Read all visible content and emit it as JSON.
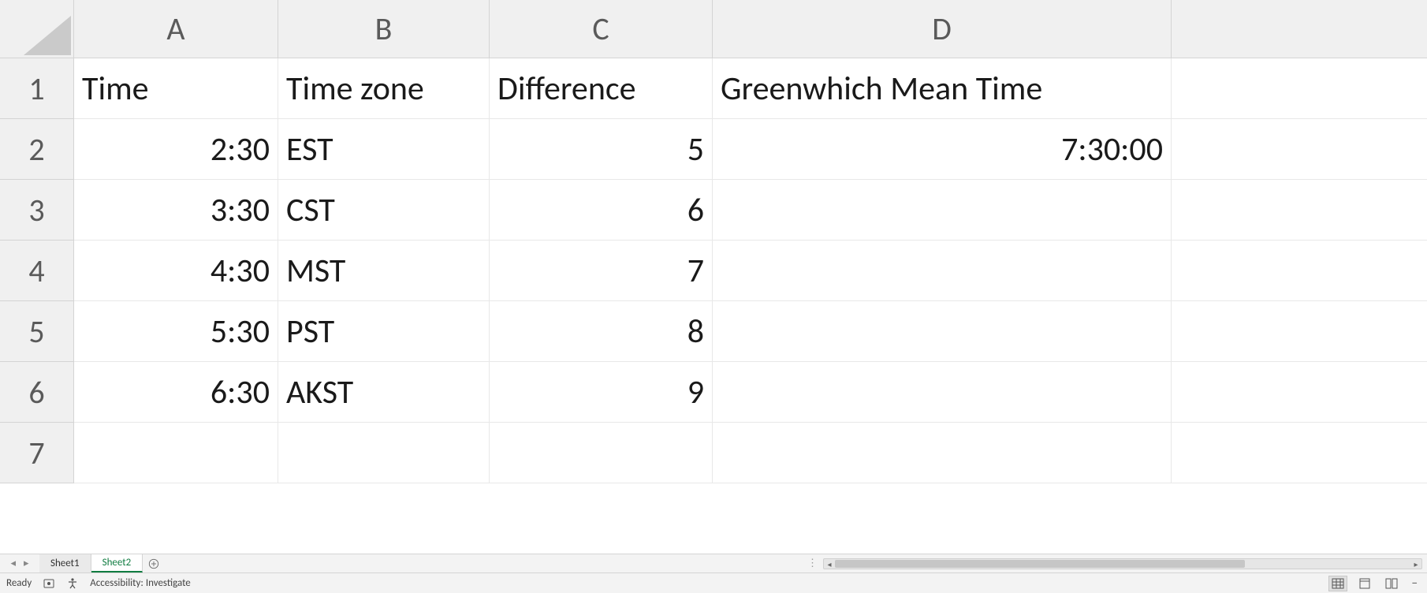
{
  "columns": [
    "A",
    "B",
    "C",
    "D"
  ],
  "rows": [
    "1",
    "2",
    "3",
    "4",
    "5",
    "6",
    "7"
  ],
  "cells": {
    "A1": "Time",
    "B1": "Time zone",
    "C1": "Difference",
    "D1": "Greenwhich Mean Time",
    "A2": "2:30",
    "B2": "EST",
    "C2": "5",
    "D2": "7:30:00",
    "A3": "3:30",
    "B3": "CST",
    "C3": "6",
    "A4": "4:30",
    "B4": "MST",
    "C4": "7",
    "A5": "5:30",
    "B5": "PST",
    "C5": "8",
    "A6": "6:30",
    "B6": "AKST",
    "C6": "9"
  },
  "sheet_tabs": {
    "tab1": "Sheet1",
    "tab2": "Sheet2"
  },
  "status": {
    "ready": "Ready",
    "accessibility": "Accessibility: Investigate"
  }
}
